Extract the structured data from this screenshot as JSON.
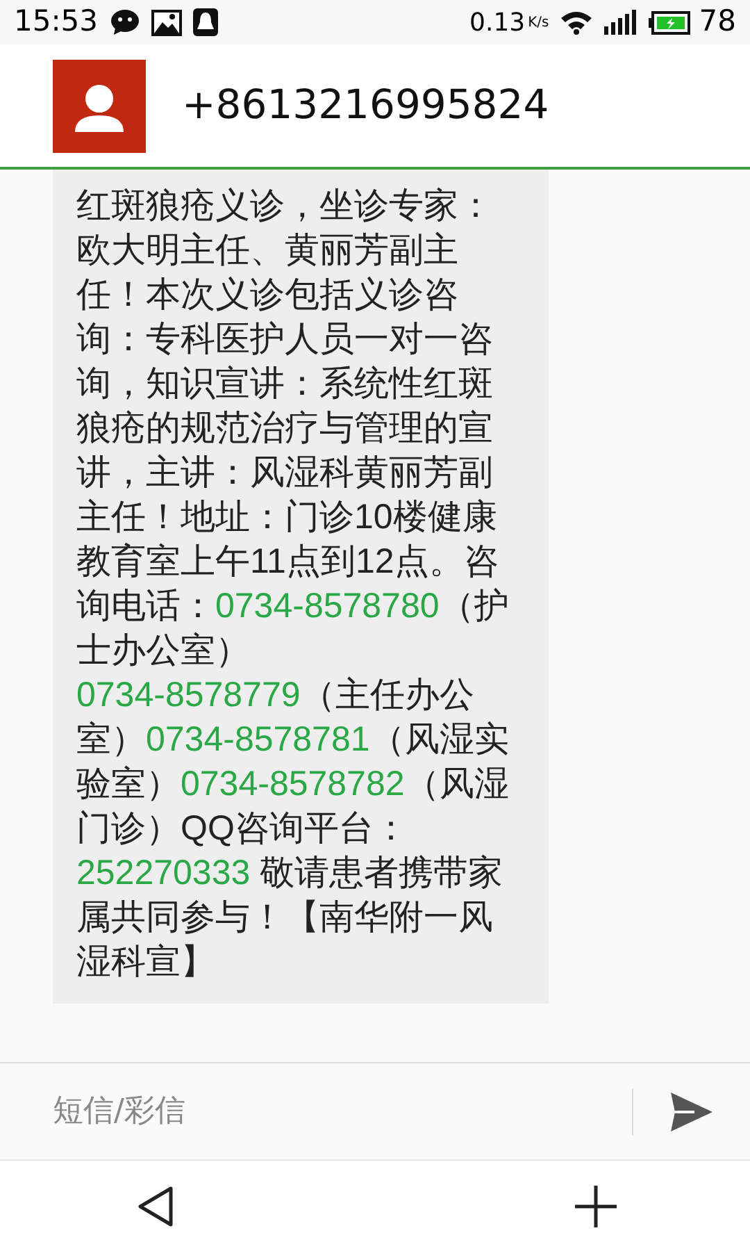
{
  "status_bar": {
    "time": "15:53",
    "speed": "0.13",
    "speed_unit": "K/s",
    "battery": "78"
  },
  "header": {
    "contact": "+8613216995824"
  },
  "message": {
    "segments": [
      {
        "kind": "text",
        "text": "红斑狼疮义诊，坐诊专家：欧大明主任、黄丽芳副主任！本次义诊包括义诊咨询：专科医护人员一对一咨询，知识宣讲：系统性红斑狼疮的规范治疗与管理的宣讲，主讲：风湿科黄丽芳副主任！地址：门诊10楼健康教育室上午11点到12点。咨询电话："
      },
      {
        "kind": "link",
        "text": "0734-8578780"
      },
      {
        "kind": "text",
        "text": "（护士办公室）\n"
      },
      {
        "kind": "link",
        "text": "0734-8578779"
      },
      {
        "kind": "text",
        "text": "（主任办公室）"
      },
      {
        "kind": "link",
        "text": "0734-8578781"
      },
      {
        "kind": "text",
        "text": "（风湿实验室）"
      },
      {
        "kind": "link",
        "text": "0734-8578782"
      },
      {
        "kind": "text",
        "text": "（风湿门诊）QQ咨询平台："
      },
      {
        "kind": "link",
        "text": "252270333"
      },
      {
        "kind": "text",
        "text": " 敬请患者携带家属共同参与！【南华附一风湿科宣】"
      }
    ]
  },
  "composer": {
    "placeholder": "短信/彩信"
  }
}
